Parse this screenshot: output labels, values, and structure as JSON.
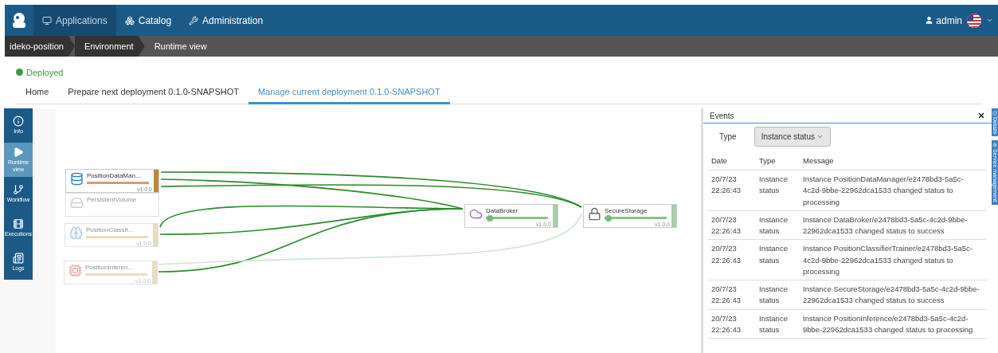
{
  "navbar": {
    "items": [
      {
        "label": "Applications",
        "selected": true
      },
      {
        "label": "Catalog",
        "selected": false
      },
      {
        "label": "Administration",
        "selected": false
      }
    ],
    "user": "admin"
  },
  "breadcrumb": [
    {
      "label": "ideko-position",
      "selected": false
    },
    {
      "label": "Environment",
      "selected": false
    },
    {
      "label": "Runtime view",
      "selected": true
    }
  ],
  "status": {
    "label": "Deployed",
    "color": "#3c9a3c"
  },
  "tabs": [
    {
      "label": "Home",
      "selected": false
    },
    {
      "label": "Prepare next deployment 0.1.0-SNAPSHOT",
      "selected": false
    },
    {
      "label": "Manage current deployment 0.1.0-SNAPSHOT",
      "selected": true
    }
  ],
  "side_menu": [
    {
      "label": "Info",
      "selected": false
    },
    {
      "label": "Runtime view",
      "selected": true
    },
    {
      "label": "Workflow",
      "selected": false
    },
    {
      "label": "Executions",
      "selected": false
    },
    {
      "label": "Logs",
      "selected": false
    }
  ],
  "nodes": [
    {
      "name": "PositionDataMan...",
      "kind": "processing",
      "version": "v1.0.0"
    },
    {
      "name": "PersistentVolume",
      "kind": "plain"
    },
    {
      "name": "PositionClassif...",
      "kind": "pending",
      "version": "v1.0.0"
    },
    {
      "name": "PositionInferen...",
      "kind": "pending",
      "version": "v1.0.0"
    },
    {
      "name": "DataBroker",
      "kind": "success",
      "version": "v1.0.0"
    },
    {
      "name": "SecureStorage",
      "kind": "success",
      "version": "v1.0.0"
    }
  ],
  "events": {
    "title": "Events",
    "filter_label": "Type",
    "filter_value": "Instance status",
    "columns": [
      "Date",
      "Type",
      "Message"
    ],
    "rows": [
      [
        "20/7/23 22:26:43",
        "Instance status",
        "Instance PositionDataManager/e2478bd3-5a5c-4c2d-9bbe-22962dca1533 changed status to processing"
      ],
      [
        "20/7/23 22:26:43",
        "Instance status",
        "Instance DataBroker/e2478bd3-5a5c-4c2d-9bbe-22962dca1533 changed status to success"
      ],
      [
        "20/7/23 22:26:43",
        "Instance status",
        "Instance PositionClassifierTrainer/e2478bd3-5a5c-4c2d-9bbe-22962dca1533 changed status to processing"
      ],
      [
        "20/7/23 22:26:43",
        "Instance status",
        "Instance SecureStorage/e2478bd3-5a5c-4c2d-9bbe-22962dca1533 changed status to success"
      ],
      [
        "20/7/23 22:26:43",
        "Instance status",
        "Instance PositionInference/e2478bd3-5a5c-4c2d-9bbe-22962dca1533 changed status to processing"
      ]
    ]
  },
  "side_tabs": [
    {
      "label": "Details"
    },
    {
      "label": "Service management"
    }
  ]
}
